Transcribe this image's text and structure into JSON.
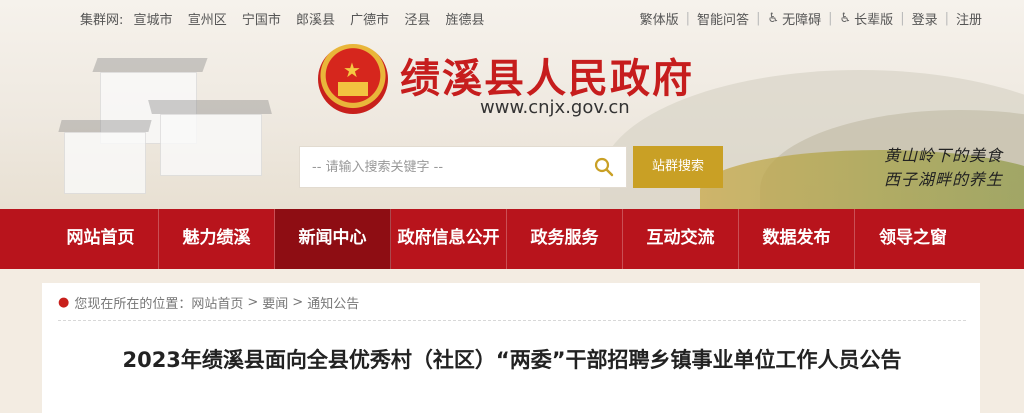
{
  "topbar": {
    "cluster_label": "集群网:",
    "cluster_links": [
      "宣城市",
      "宣州区",
      "宁国市",
      "郎溪县",
      "广德市",
      "泾县",
      "旌德县"
    ],
    "right_links": [
      "繁体版",
      "智能问答",
      "无障碍",
      "长辈版",
      "登录",
      "注册"
    ]
  },
  "header": {
    "title": "绩溪县人民政府",
    "url": "www.cnjx.gov.cn",
    "search_placeholder": "-- 请输入搜索关键字 --",
    "search_button": "站群搜索",
    "slogan_line1": "黄山岭下的美食",
    "slogan_line2": "西子湖畔的养生"
  },
  "nav": {
    "items": [
      "网站首页",
      "魅力绩溪",
      "新闻中心",
      "政府信息公开",
      "政务服务",
      "互动交流",
      "数据发布",
      "领导之窗"
    ],
    "active_index": 2
  },
  "breadcrumb": {
    "prefix": "您现在所在的位置：",
    "items": [
      "网站首页",
      "要闻",
      "通知公告"
    ],
    "separator": ">"
  },
  "article": {
    "title": "2023年绩溪县面向全县优秀村（社区）“两委”干部招聘乡镇事业单位工作人员公告"
  },
  "colors": {
    "nav_red": "#b8141c",
    "title_red": "#c61d1d",
    "search_gold": "#c9a025"
  },
  "icons": [
    "search-icon",
    "accessibility-icon",
    "elder-icon",
    "location-pin-icon",
    "national-emblem"
  ]
}
